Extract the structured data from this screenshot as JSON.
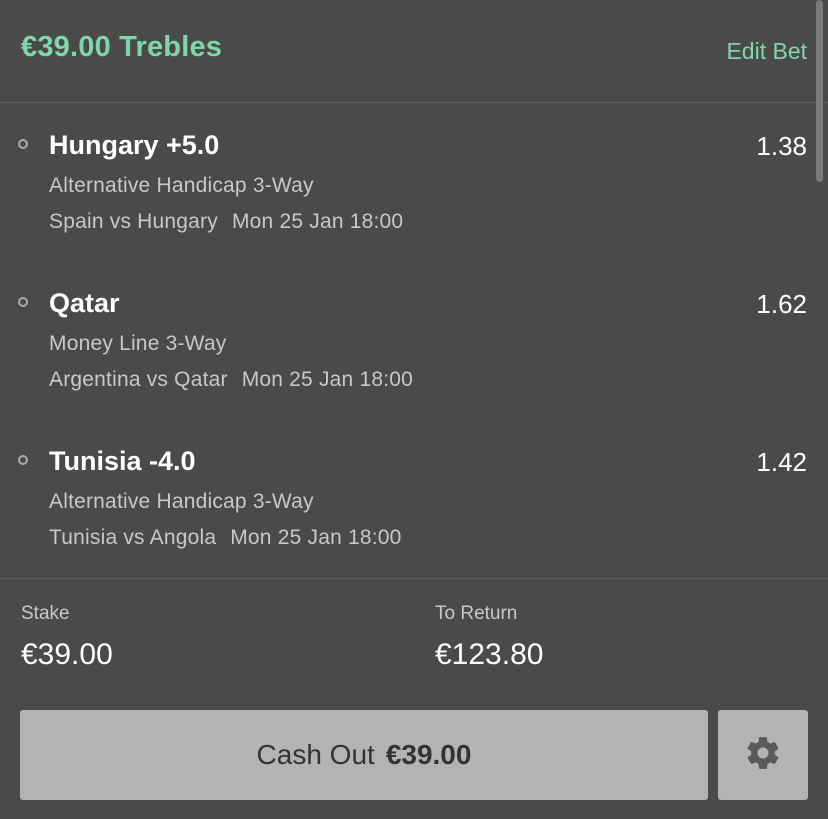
{
  "header": {
    "title": "€39.00 Trebles",
    "edit_label": "Edit Bet"
  },
  "selections": [
    {
      "name": "Hungary +5.0",
      "odds": "1.38",
      "market": "Alternative Handicap 3-Way",
      "event": "Spain vs Hungary",
      "time": "Mon 25 Jan 18:00"
    },
    {
      "name": "Qatar",
      "odds": "1.62",
      "market": "Money Line 3-Way",
      "event": "Argentina vs Qatar",
      "time": "Mon 25 Jan 18:00"
    },
    {
      "name": "Tunisia -4.0",
      "odds": "1.42",
      "market": "Alternative Handicap 3-Way",
      "event": "Tunisia vs Angola",
      "time": "Mon 25 Jan 18:00"
    }
  ],
  "summary": {
    "stake_label": "Stake",
    "stake_value": "€39.00",
    "return_label": "To Return",
    "return_value": "€123.80"
  },
  "cashout": {
    "label": "Cash Out",
    "amount": "€39.00"
  },
  "icons": {
    "settings": "gear-icon"
  },
  "colors": {
    "accent": "#7fd6ad",
    "background": "#4a4a4a",
    "button": "#b3b3b3"
  }
}
